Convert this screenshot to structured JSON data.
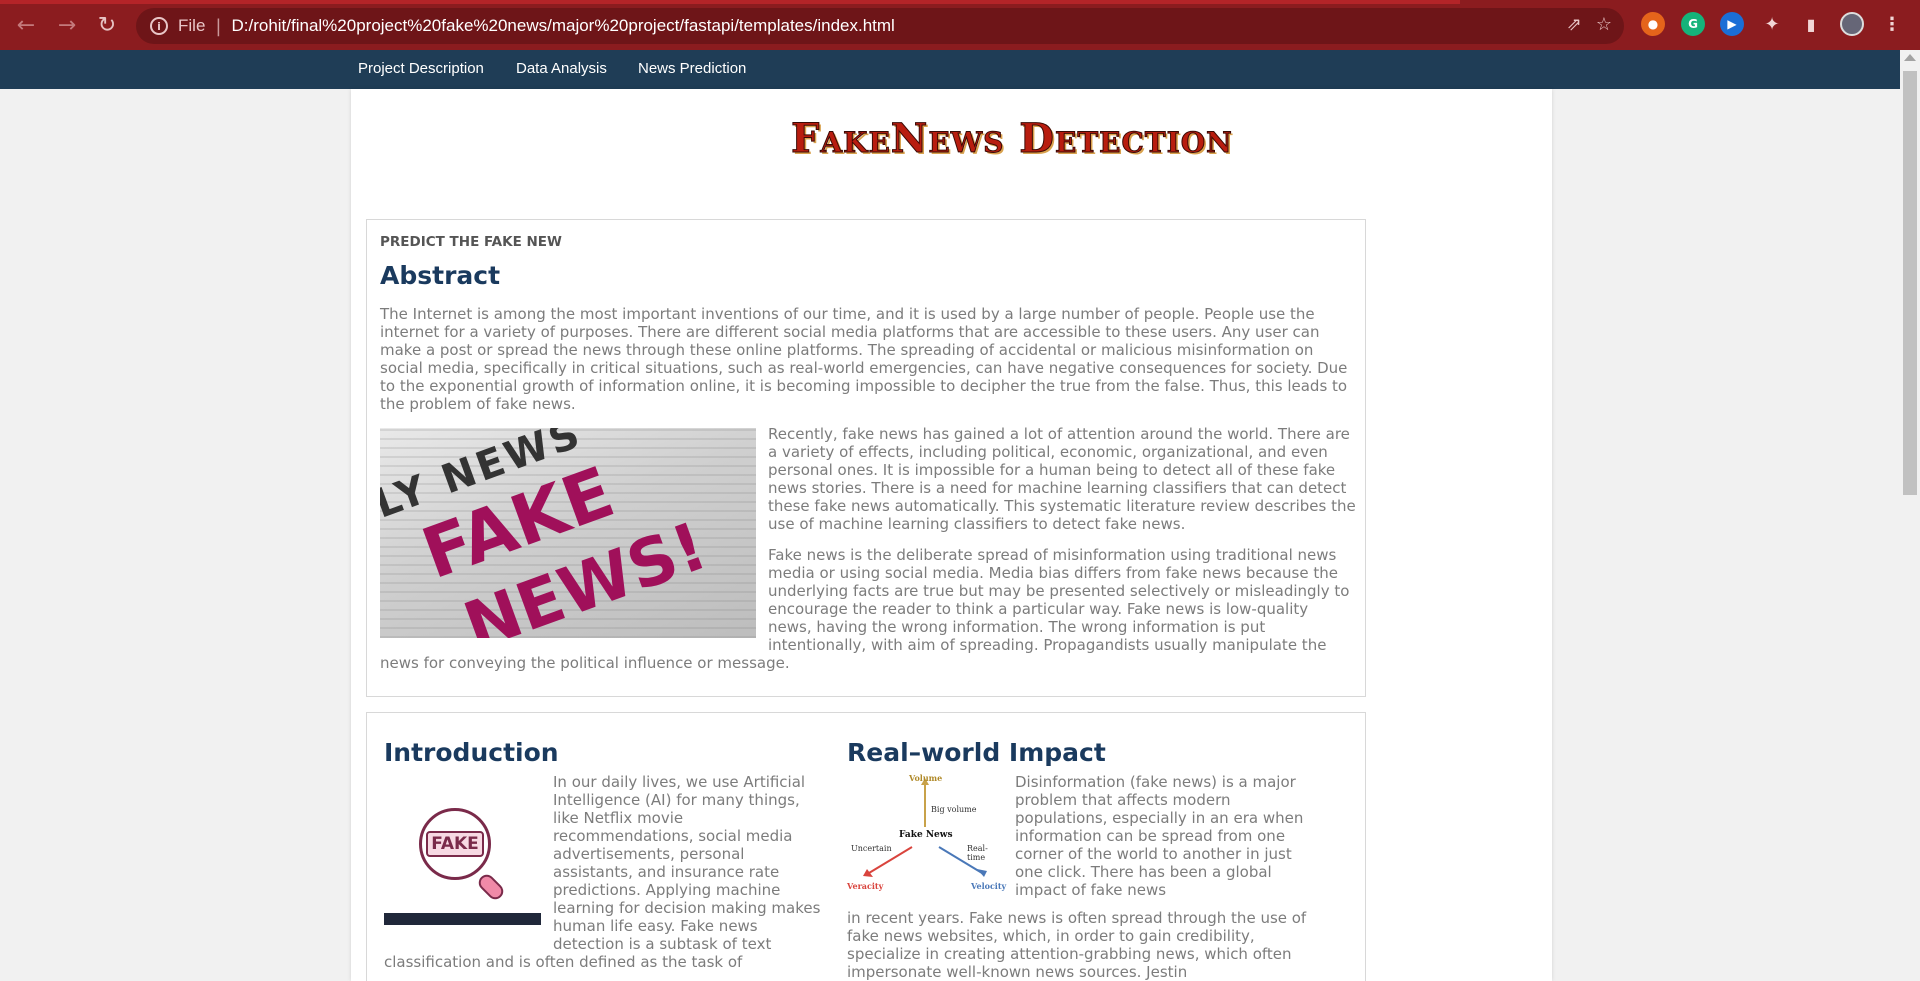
{
  "browser": {
    "file_label": "File",
    "url": "D:/rohit/final%20project%20fake%20news/major%20project/fastapi/templates/index.html"
  },
  "nav": {
    "items": [
      "Project Description",
      "Data Analysis",
      "News Prediction"
    ]
  },
  "banner": {
    "title": "FakeNews Detection"
  },
  "abstract_section": {
    "kicker": "PREDICT THE FAKE NEW",
    "heading": "Abstract",
    "p1": "The Internet is among the most important inventions of our time, and it is used by a large number of people. People use the internet for a variety of purposes. There are different social media platforms that are accessible to these users. Any user can make a post or spread the news through these online platforms. The spreading of accidental or malicious misinformation on social media, specifically in critical situations, such as real-world emergencies, can have negative consequences for society. Due to the exponential growth of information online, it is becoming impossible to decipher the true from the false. Thus, this leads to the problem of fake news.",
    "p2": "Recently, fake news has gained a lot of attention around the world. There are a variety of effects, including political, economic, organizational, and even personal ones. It is impossible for a human being to detect all of these fake news stories. There is a need for machine learning classifiers that can detect these fake news automatically. This systematic literature review describes the use of machine learning classifiers to detect fake news.",
    "p3": "Fake news is the deliberate spread of misinformation using traditional news media or using social media. Media bias differs from fake news because the underlying facts are true but may be presented selectively or misleadingly to encourage the reader to think a particular way. Fake news is low-quality news, having the wrong information. The wrong information is put intentionally, with aim of spreading. Propagandists usually manipulate the",
    "p3_tail": "news for conveying the political influence or message.",
    "image_text": {
      "line1": "LY NEWS",
      "line2": "FAKE",
      "line3": "NEWS!"
    }
  },
  "intro_section": {
    "heading": "Introduction",
    "icon_text": "FAKE",
    "text1": "In our daily lives, we use Artificial Intelligence (AI) for many things, like Netflix movie recommendations, social media advertisements, personal assistants, and insurance rate predictions. Applying machine learning for decision making makes human life easy. Fake news detection is a subtask of text",
    "text2": "classification and is often defined as the task of"
  },
  "impact_section": {
    "heading": "Real–world Impact",
    "diagram": {
      "center": "Fake News",
      "volume": "Volume",
      "big_volume": "Big volume",
      "uncertain": "Uncertain",
      "realtime": "Real-time",
      "veracity": "Veracity",
      "velocity": "Velocity"
    },
    "text1": "Disinformation (fake news) is a major problem that affects modern populations, especially in an era when information can be spread from one corner of the world to another in just one click. There has been a global impact of fake news",
    "text2": "in recent years. Fake news is often spread through the use of fake news websites, which, in order to gain credibility, specialize in creating attention-grabbing news, which often impersonate well-known news sources. Jestin"
  }
}
